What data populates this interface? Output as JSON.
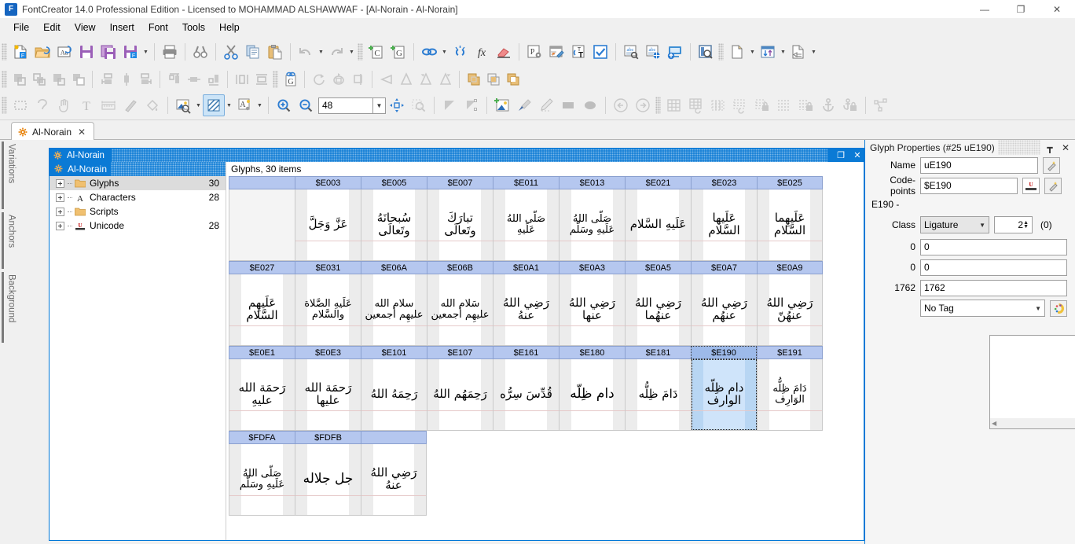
{
  "window": {
    "title": "FontCreator 14.0 Professional Edition - Licensed to MOHAMMAD ALSHAWWAF - [Al-Norain  - Al-Norain]",
    "app_icon_letter": "F",
    "minimize": "—",
    "maximize": "❐",
    "close": "✕"
  },
  "menu": {
    "items": [
      {
        "label": "File"
      },
      {
        "label": "Edit"
      },
      {
        "label": "View"
      },
      {
        "label": "Insert"
      },
      {
        "label": "Font"
      },
      {
        "label": "Tools"
      },
      {
        "label": "Help"
      }
    ]
  },
  "toolbar_standard": {
    "buttons": [
      {
        "name": "new-font-icon"
      },
      {
        "name": "open-font-icon"
      },
      {
        "name": "install-font-icon"
      },
      {
        "name": "save-icon"
      },
      {
        "name": "save-all-icon"
      },
      {
        "name": "save-as-icon"
      },
      {
        "name": "print-icon"
      },
      {
        "name": "find-icon"
      },
      {
        "name": "cut-icon"
      },
      {
        "name": "copy-icon"
      },
      {
        "name": "paste-icon"
      },
      {
        "name": "undo-icon"
      },
      {
        "name": "redo-icon"
      },
      {
        "name": "add-character-icon"
      },
      {
        "name": "add-glyph-icon"
      },
      {
        "name": "link-glyph-icon"
      },
      {
        "name": "unlink-glyph-icon"
      },
      {
        "name": "transform-fx-icon"
      },
      {
        "name": "clear-icon"
      },
      {
        "name": "font-properties-icon"
      },
      {
        "name": "edit-metadata-icon"
      },
      {
        "name": "transform-text-icon"
      },
      {
        "name": "validate-icon"
      },
      {
        "name": "test-font-icon"
      },
      {
        "name": "web-font-preview-icon"
      },
      {
        "name": "install-preview-icon"
      },
      {
        "name": "font-report-icon"
      },
      {
        "name": "new-document-icon"
      },
      {
        "name": "sort-glyphs-icon"
      },
      {
        "name": "script-icon"
      }
    ]
  },
  "toolbar_arrange": {
    "buttons": [
      {
        "name": "bring-to-front-icon"
      },
      {
        "name": "bring-forward-icon"
      },
      {
        "name": "send-backward-icon"
      },
      {
        "name": "send-to-back-icon"
      },
      {
        "name": "align-left-icon"
      },
      {
        "name": "align-center-horizontal-icon"
      },
      {
        "name": "align-right-icon"
      },
      {
        "name": "align-top-icon"
      },
      {
        "name": "align-middle-icon"
      },
      {
        "name": "align-bottom-icon"
      },
      {
        "name": "distribute-horizontal-icon"
      },
      {
        "name": "distribute-vertical-icon"
      },
      {
        "name": "composite-glyph-icon"
      },
      {
        "name": "rotate-cw-icon"
      },
      {
        "name": "rotate-ccw-icon"
      },
      {
        "name": "flip-free-icon"
      },
      {
        "name": "flip-horizontal-icon"
      },
      {
        "name": "slant-left-icon"
      },
      {
        "name": "slant-right-icon"
      },
      {
        "name": "union-icon"
      },
      {
        "name": "intersect-icon"
      },
      {
        "name": "exclude-icon"
      }
    ]
  },
  "toolbar_tools": {
    "buttons": [
      {
        "name": "select-tool-icon"
      },
      {
        "name": "lasso-tool-icon"
      },
      {
        "name": "pan-tool-icon"
      },
      {
        "name": "text-tool-icon"
      },
      {
        "name": "measure-tool-icon"
      },
      {
        "name": "knife-tool-icon"
      },
      {
        "name": "fill-tool-icon"
      },
      {
        "name": "image-preview-icon"
      },
      {
        "name": "contour-style-icon"
      },
      {
        "name": "glyph-style-icon"
      },
      {
        "name": "zoom-in-icon"
      },
      {
        "name": "zoom-out-icon"
      },
      {
        "name": "fit-to-window-icon"
      },
      {
        "name": "zoom-region-icon"
      },
      {
        "name": "corner-point-icon"
      },
      {
        "name": "curve-point-icon"
      },
      {
        "name": "insert-image-icon"
      },
      {
        "name": "brush-tool-icon"
      },
      {
        "name": "pencil-tool-icon"
      },
      {
        "name": "rectangle-tool-icon"
      },
      {
        "name": "ellipse-tool-icon"
      },
      {
        "name": "previous-glyph-icon"
      },
      {
        "name": "next-glyph-icon"
      },
      {
        "name": "grid-icon"
      },
      {
        "name": "grid-snap-icon"
      },
      {
        "name": "guidelines-icon"
      },
      {
        "name": "guidelines-snap-icon"
      },
      {
        "name": "lock-guidelines-icon"
      },
      {
        "name": "vertical-metrics-icon"
      },
      {
        "name": "lock-metrics-icon"
      },
      {
        "name": "anchors-icon"
      },
      {
        "name": "lock-anchors-icon"
      },
      {
        "name": "skeleton-icon"
      }
    ],
    "zoom_value": "48",
    "zoom_placeholder": "48"
  },
  "document_tab": {
    "label": "Al-Norain",
    "close": "✕"
  },
  "side_dock": {
    "tabs": [
      {
        "label": "Variations"
      },
      {
        "label": "Anchors"
      },
      {
        "label": "Background"
      }
    ]
  },
  "mdi_window": {
    "title": "Al-Norain",
    "restore": "❐",
    "close": "✕"
  },
  "tree": {
    "root": "Al-Norain",
    "nodes": [
      {
        "label": "Glyphs",
        "count": "30",
        "icon": "folder-icon",
        "selected": true
      },
      {
        "label": "Characters",
        "count": "28",
        "icon": "letter-a-icon",
        "selected": false
      },
      {
        "label": "Scripts",
        "count": "",
        "icon": "folder-icon",
        "selected": false
      },
      {
        "label": "Unicode",
        "count": "28",
        "icon": "unicode-icon",
        "selected": false
      }
    ]
  },
  "glyph_grid": {
    "status": "Glyphs, 30 items",
    "columns": 9,
    "rows": [
      {
        "cells": [
          {
            "code": "",
            "glyph": "",
            "kind": "empty",
            "selected": false
          },
          {
            "code": "$E003",
            "glyph": "عَزَّ وَجَلَّ",
            "kind": "glyph",
            "selected": false
          },
          {
            "code": "$E005",
            "glyph": "سُبحانَهُ وتَعالَى",
            "kind": "glyph",
            "selected": false
          },
          {
            "code": "$E007",
            "glyph": "تبارَكَ وتَعالَى",
            "kind": "glyph",
            "selected": false
          },
          {
            "code": "$E011",
            "glyph": "صَلّى اللهُ عَلَيهِ",
            "kind": "glyph",
            "selected": false
          },
          {
            "code": "$E013",
            "glyph": "صَلّى اللهُ عَلَيهِ وسَلّم",
            "kind": "glyph",
            "selected": false
          },
          {
            "code": "$E021",
            "glyph": "عَلَيهِ السَّلام",
            "kind": "glyph",
            "selected": false
          },
          {
            "code": "$E023",
            "glyph": "عَلَيها السَّلام",
            "kind": "glyph",
            "selected": false
          },
          {
            "code": "$E025",
            "glyph": "عَلَيهِما السَّلام",
            "kind": "glyph",
            "selected": false
          }
        ]
      },
      {
        "cells": [
          {
            "code": "$E027",
            "glyph": "عَلَيهِم السَّلام",
            "kind": "glyph",
            "selected": false
          },
          {
            "code": "$E031",
            "glyph": "عَلَيهِ الصَّلاة والسَّلام",
            "kind": "glyph",
            "selected": false
          },
          {
            "code": "$E06A",
            "glyph": "سلام الله عليهِم أجمعين",
            "kind": "glyph",
            "selected": false
          },
          {
            "code": "$E06B",
            "glyph": "سَلام الله عليهِم أجمعين",
            "kind": "glyph",
            "selected": false
          },
          {
            "code": "$E0A1",
            "glyph": "رَضِي اللهُ عنهُ",
            "kind": "glyph",
            "selected": false
          },
          {
            "code": "$E0A3",
            "glyph": "رَضِي اللهُ عنها",
            "kind": "glyph",
            "selected": false
          },
          {
            "code": "$E0A5",
            "glyph": "رَضِي اللهُ عنهُما",
            "kind": "glyph",
            "selected": false
          },
          {
            "code": "$E0A7",
            "glyph": "رَضِي اللهُ عنهُم",
            "kind": "glyph",
            "selected": false
          },
          {
            "code": "$E0A9",
            "glyph": "رَضِي اللهُ عنهُنّ",
            "kind": "glyph",
            "selected": false
          }
        ]
      },
      {
        "cells": [
          {
            "code": "$E0E1",
            "glyph": "رَحمَة الله عليهِ",
            "kind": "glyph",
            "selected": false
          },
          {
            "code": "$E0E3",
            "glyph": "رَحمَة الله عليها",
            "kind": "glyph",
            "selected": false
          },
          {
            "code": "$E101",
            "glyph": "رَحِمَهُ اللهُ",
            "kind": "glyph",
            "selected": false
          },
          {
            "code": "$E107",
            "glyph": "رَحِمَهُم اللهُ",
            "kind": "glyph",
            "selected": false
          },
          {
            "code": "$E161",
            "glyph": "قُدِّسَ سِرُّه",
            "kind": "glyph",
            "selected": false
          },
          {
            "code": "$E180",
            "glyph": "دام ظِلّه",
            "kind": "glyph",
            "selected": false
          },
          {
            "code": "$E181",
            "glyph": "دَامَ ظِلُّه",
            "kind": "glyph",
            "selected": false
          },
          {
            "code": "$E190",
            "glyph": "دام ظِلّه الوارف",
            "kind": "glyph",
            "selected": true
          },
          {
            "code": "$E191",
            "glyph": "دَامَ ظِلُّه الوَارِف",
            "kind": "glyph",
            "selected": false
          }
        ]
      },
      {
        "cells": [
          {
            "code": "$FDFA",
            "glyph": "صَلّى اللهُ عَلَيهِ وسَلّم",
            "kind": "glyph",
            "selected": false
          },
          {
            "code": "$FDFB",
            "glyph": "جل جلاله",
            "kind": "glyph",
            "selected": false
          },
          {
            "code": "",
            "glyph": "رَضِي اللهُ عنهُ",
            "kind": "glyph",
            "selected": false
          }
        ]
      }
    ]
  },
  "properties": {
    "title": "Glyph Properties (#25 uE190)",
    "pin": "┳",
    "close": "✕",
    "fields": {
      "name_label": "Name",
      "name_value": "uE190",
      "codepoints_label": "Code-points",
      "codepoints_value": "$E190",
      "range_text": "E190 -",
      "class_label": "Class",
      "class_value": "Ligature",
      "class_count": "2",
      "class_paren": "(0)",
      "lsb_readonly": "0",
      "lsb_value": "0",
      "rsb_readonly": "0",
      "rsb_value": "0",
      "advance_readonly": "1762",
      "advance_value": "1762",
      "tag_value": "No Tag"
    }
  }
}
